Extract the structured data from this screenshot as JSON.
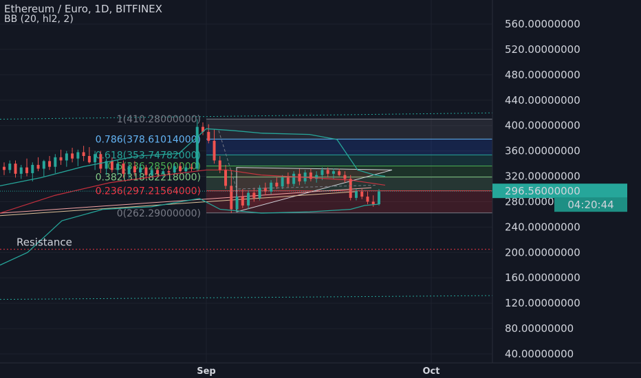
{
  "header": {
    "title": "Ethereum / Euro, 1D, BITFINEX",
    "indicator": "BB (20, hl2, 2)"
  },
  "colors": {
    "background": "#131722",
    "up": "#26a69a",
    "down": "#ef5350",
    "bb_line": "#26a69a",
    "grid": "#1e222d",
    "text": "#d1d4dc"
  },
  "price_label": "296.56000000",
  "countdown": "04:20:44",
  "chart_data": {
    "type": "candlestick",
    "ylim": [
      20,
      580
    ],
    "y_ticks": [
      40,
      80,
      120,
      160,
      200,
      240,
      280,
      320,
      360,
      400,
      440,
      480,
      520,
      560
    ],
    "y_tick_labels": [
      "40.00000000",
      "80.00000000",
      "120.00000000",
      "160.00000000",
      "200.00000000",
      "240.00000000",
      "280.00000000",
      "320.00000000",
      "360.00000000",
      "400.00000000",
      "440.00000000",
      "480.00000000",
      "520.00000000",
      "560.00000000"
    ],
    "x_labels": [
      "Sep",
      "Oct"
    ],
    "fib_levels": [
      {
        "ratio": 1,
        "value": 410.28,
        "label": "1(410.28000000)",
        "color": "#787b86"
      },
      {
        "ratio": 0.786,
        "value": 378.61014,
        "label": "0.786(378.61014000)",
        "color": "#64b5f6"
      },
      {
        "ratio": 0.618,
        "value": 353.74782,
        "label": "0.618(353.74782000)",
        "color": "#26a69a"
      },
      {
        "ratio": 0.5,
        "value": 336.285,
        "label": "0.5(336.28500000)",
        "color": "#4caf50"
      },
      {
        "ratio": 0.382,
        "value": 318.82218,
        "label": "0.382(318.82218000)",
        "color": "#81c784"
      },
      {
        "ratio": 0.236,
        "value": 297.21564,
        "label": "0.236(297.21564000)",
        "color": "#f23645"
      },
      {
        "ratio": 0,
        "value": 262.29,
        "label": "0(262.29000000)",
        "color": "#787b86"
      }
    ],
    "annotations": [
      {
        "text": "Resistance",
        "value": 205
      }
    ],
    "last_price": 296.56,
    "candles": [
      {
        "o": 335,
        "h": 342,
        "l": 322,
        "c": 330
      },
      {
        "o": 330,
        "h": 345,
        "l": 325,
        "c": 340
      },
      {
        "o": 340,
        "h": 345,
        "l": 318,
        "c": 324
      },
      {
        "o": 324,
        "h": 338,
        "l": 316,
        "c": 334
      },
      {
        "o": 334,
        "h": 348,
        "l": 320,
        "c": 325
      },
      {
        "o": 325,
        "h": 342,
        "l": 312,
        "c": 338
      },
      {
        "o": 338,
        "h": 350,
        "l": 328,
        "c": 332
      },
      {
        "o": 332,
        "h": 346,
        "l": 320,
        "c": 344
      },
      {
        "o": 344,
        "h": 352,
        "l": 330,
        "c": 335
      },
      {
        "o": 335,
        "h": 355,
        "l": 325,
        "c": 350
      },
      {
        "o": 350,
        "h": 362,
        "l": 338,
        "c": 345
      },
      {
        "o": 345,
        "h": 360,
        "l": 335,
        "c": 356
      },
      {
        "o": 356,
        "h": 365,
        "l": 342,
        "c": 348
      },
      {
        "o": 348,
        "h": 362,
        "l": 336,
        "c": 358
      },
      {
        "o": 358,
        "h": 368,
        "l": 344,
        "c": 352
      },
      {
        "o": 352,
        "h": 366,
        "l": 340,
        "c": 342
      },
      {
        "o": 342,
        "h": 360,
        "l": 330,
        "c": 355
      },
      {
        "o": 355,
        "h": 360,
        "l": 325,
        "c": 332
      },
      {
        "o": 332,
        "h": 348,
        "l": 322,
        "c": 344
      },
      {
        "o": 344,
        "h": 350,
        "l": 326,
        "c": 330
      },
      {
        "o": 330,
        "h": 346,
        "l": 322,
        "c": 340
      },
      {
        "o": 340,
        "h": 345,
        "l": 318,
        "c": 324
      },
      {
        "o": 324,
        "h": 342,
        "l": 316,
        "c": 336
      },
      {
        "o": 336,
        "h": 344,
        "l": 320,
        "c": 326
      },
      {
        "o": 326,
        "h": 340,
        "l": 318,
        "c": 334
      },
      {
        "o": 334,
        "h": 338,
        "l": 316,
        "c": 322
      },
      {
        "o": 322,
        "h": 336,
        "l": 318,
        "c": 330
      },
      {
        "o": 330,
        "h": 334,
        "l": 320,
        "c": 324
      },
      {
        "o": 324,
        "h": 332,
        "l": 318,
        "c": 328
      },
      {
        "o": 328,
        "h": 336,
        "l": 322,
        "c": 326
      },
      {
        "o": 326,
        "h": 340,
        "l": 322,
        "c": 336
      },
      {
        "o": 336,
        "h": 342,
        "l": 326,
        "c": 328
      },
      {
        "o": 328,
        "h": 338,
        "l": 324,
        "c": 334
      },
      {
        "o": 334,
        "h": 340,
        "l": 328,
        "c": 332
      },
      {
        "o": 332,
        "h": 410,
        "l": 328,
        "c": 398
      },
      {
        "o": 398,
        "h": 405,
        "l": 385,
        "c": 390
      },
      {
        "o": 390,
        "h": 402,
        "l": 372,
        "c": 376
      },
      {
        "o": 376,
        "h": 394,
        "l": 340,
        "c": 345
      },
      {
        "o": 345,
        "h": 352,
        "l": 325,
        "c": 330
      },
      {
        "o": 330,
        "h": 338,
        "l": 300,
        "c": 305
      },
      {
        "o": 305,
        "h": 330,
        "l": 262,
        "c": 268
      },
      {
        "o": 268,
        "h": 292,
        "l": 264,
        "c": 288
      },
      {
        "o": 288,
        "h": 300,
        "l": 270,
        "c": 274
      },
      {
        "o": 274,
        "h": 298,
        "l": 268,
        "c": 294
      },
      {
        "o": 294,
        "h": 302,
        "l": 280,
        "c": 286
      },
      {
        "o": 286,
        "h": 306,
        "l": 282,
        "c": 302
      },
      {
        "o": 302,
        "h": 310,
        "l": 290,
        "c": 296
      },
      {
        "o": 296,
        "h": 314,
        "l": 292,
        "c": 310
      },
      {
        "o": 310,
        "h": 318,
        "l": 300,
        "c": 304
      },
      {
        "o": 304,
        "h": 322,
        "l": 300,
        "c": 318
      },
      {
        "o": 318,
        "h": 326,
        "l": 302,
        "c": 308
      },
      {
        "o": 308,
        "h": 328,
        "l": 304,
        "c": 324
      },
      {
        "o": 324,
        "h": 332,
        "l": 306,
        "c": 312
      },
      {
        "o": 312,
        "h": 330,
        "l": 308,
        "c": 326
      },
      {
        "o": 326,
        "h": 332,
        "l": 312,
        "c": 316
      },
      {
        "o": 316,
        "h": 328,
        "l": 310,
        "c": 322
      },
      {
        "o": 322,
        "h": 334,
        "l": 314,
        "c": 330
      },
      {
        "o": 330,
        "h": 334,
        "l": 318,
        "c": 324
      },
      {
        "o": 324,
        "h": 332,
        "l": 316,
        "c": 328
      },
      {
        "o": 328,
        "h": 332,
        "l": 320,
        "c": 322
      },
      {
        "o": 322,
        "h": 328,
        "l": 310,
        "c": 316
      },
      {
        "o": 316,
        "h": 322,
        "l": 282,
        "c": 286
      },
      {
        "o": 286,
        "h": 300,
        "l": 282,
        "c": 296
      },
      {
        "o": 296,
        "h": 300,
        "l": 284,
        "c": 288
      },
      {
        "o": 288,
        "h": 296,
        "l": 276,
        "c": 280
      },
      {
        "o": 280,
        "h": 290,
        "l": 272,
        "c": 276
      },
      {
        "o": 276,
        "h": 300,
        "l": 274,
        "c": 296
      }
    ]
  }
}
